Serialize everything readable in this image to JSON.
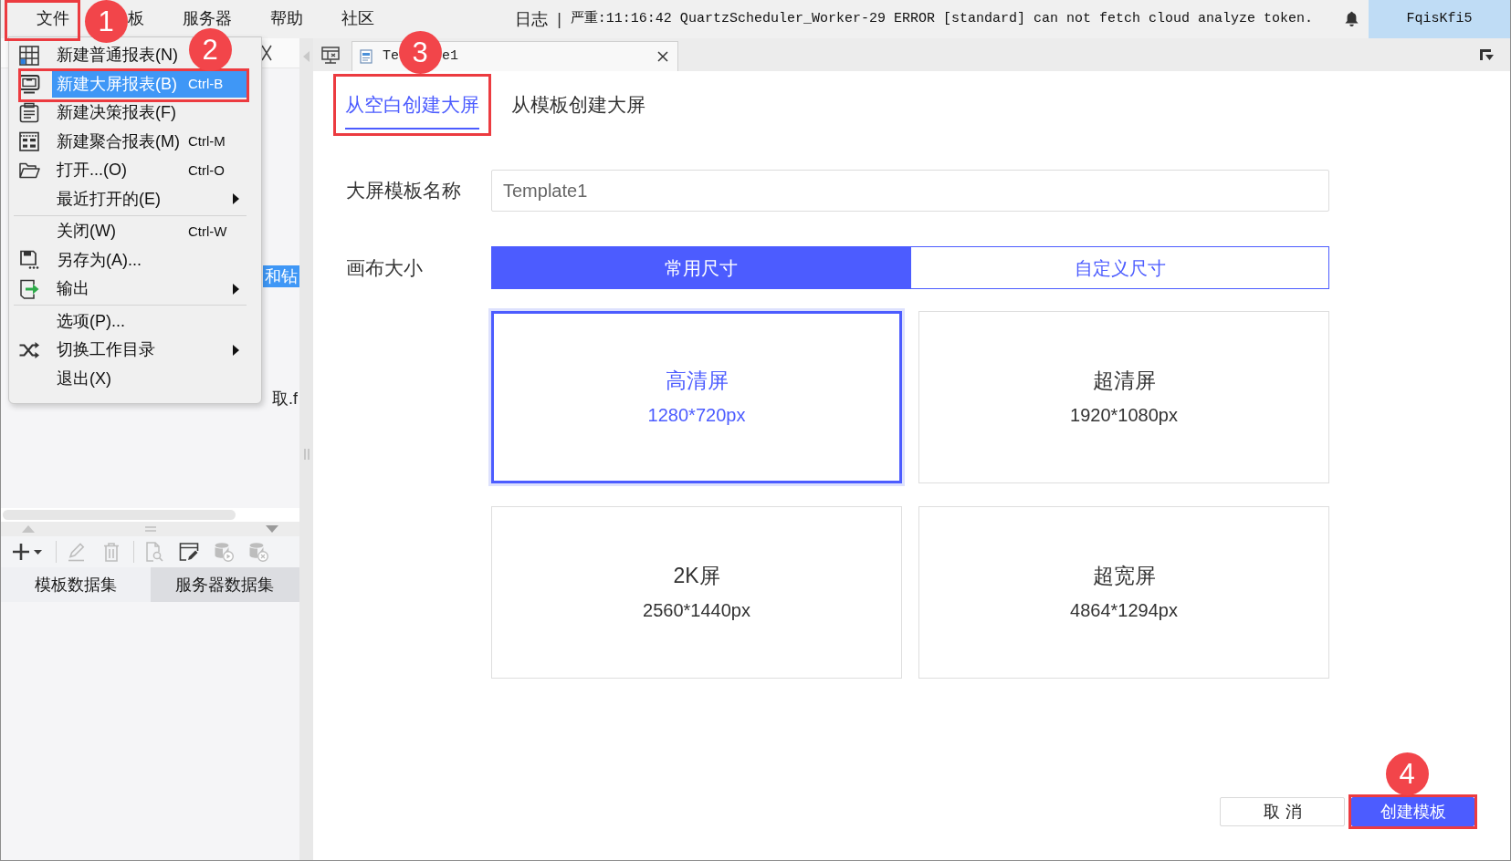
{
  "menubar": {
    "items": [
      {
        "label": "文件",
        "outlined": true,
        "callout": "1"
      },
      {
        "label": "板"
      },
      {
        "label": "服务器"
      },
      {
        "label": "帮助"
      },
      {
        "label": "社区"
      }
    ]
  },
  "log": {
    "label": "日志",
    "separator": "|",
    "message": "严重:11:16:42 QuartzScheduler_Worker-29 ERROR [standard] can not fetch cloud analyze token."
  },
  "user": {
    "name": "FqisKfi5"
  },
  "file_menu": {
    "sections": [
      [
        {
          "label": "新建普通报表(N)",
          "selected": false
        },
        {
          "label": "新建大屏报表(B)",
          "shortcut": "Ctrl-B",
          "selected": true,
          "outlined": true,
          "callout": "2"
        },
        {
          "label": "新建决策报表(F)",
          "selected": false
        },
        {
          "label": "新建聚合报表(M)",
          "shortcut": "Ctrl-M",
          "selected": false
        },
        {
          "label": "打开...(O)",
          "shortcut": "Ctrl-O",
          "selected": false
        },
        {
          "label": "最近打开的(E)",
          "submenu": true,
          "selected": false
        }
      ],
      [
        {
          "label": "关闭(W)",
          "shortcut": "Ctrl-W",
          "selected": false
        },
        {
          "label": "另存为(A)...",
          "selected": false
        },
        {
          "label": "输出",
          "submenu": true,
          "selected": false
        }
      ],
      [
        {
          "label": "选项(P)...",
          "selected": false
        },
        {
          "label": "切换工作目录",
          "submenu": true,
          "selected": false
        },
        {
          "label": "退出(X)",
          "selected": false
        }
      ]
    ]
  },
  "left_panel": {
    "tree": [
      {
        "label": "和钻",
        "selected": true
      },
      {
        "label": "取.f",
        "selected": false
      }
    ],
    "toolbar_groups": [
      [
        {
          "disabled": false
        }
      ],
      [
        {
          "disabled": true
        },
        {
          "disabled": true
        }
      ],
      [
        {
          "disabled": true
        },
        {
          "disabled": false
        },
        {
          "disabled": true
        },
        {
          "disabled": true
        }
      ]
    ],
    "dataset_tabs": [
      {
        "label": "模板数据集",
        "selected": true
      },
      {
        "label": "服务器数据集",
        "selected": false
      }
    ]
  },
  "document_tab": {
    "title_visible": [
      "Te",
      "e1"
    ],
    "callout": "3"
  },
  "create_tabs": [
    {
      "label": "从空白创建大屏",
      "selected": true,
      "outlined": true
    },
    {
      "label": "从模板创建大屏",
      "selected": false
    }
  ],
  "name_field": {
    "label": "大屏模板名称",
    "value": "Template1"
  },
  "canvas_size": {
    "label": "画布大小",
    "modes": [
      {
        "label": "常用尺寸",
        "selected": true
      },
      {
        "label": "自定义尺寸",
        "selected": false
      }
    ],
    "presets": [
      {
        "title": "高清屏",
        "size": "1280*720px",
        "selected": true
      },
      {
        "title": "超清屏",
        "size": "1920*1080px",
        "selected": false
      },
      {
        "title": "2K屏",
        "size": "2560*1440px",
        "selected": false
      },
      {
        "title": "超宽屏",
        "size": "4864*1294px",
        "selected": false
      }
    ]
  },
  "buttons": [
    {
      "label": "取消",
      "kind": "secondary"
    },
    {
      "label": "创建模板",
      "kind": "primary",
      "outlined": true,
      "callout": "4"
    }
  ]
}
